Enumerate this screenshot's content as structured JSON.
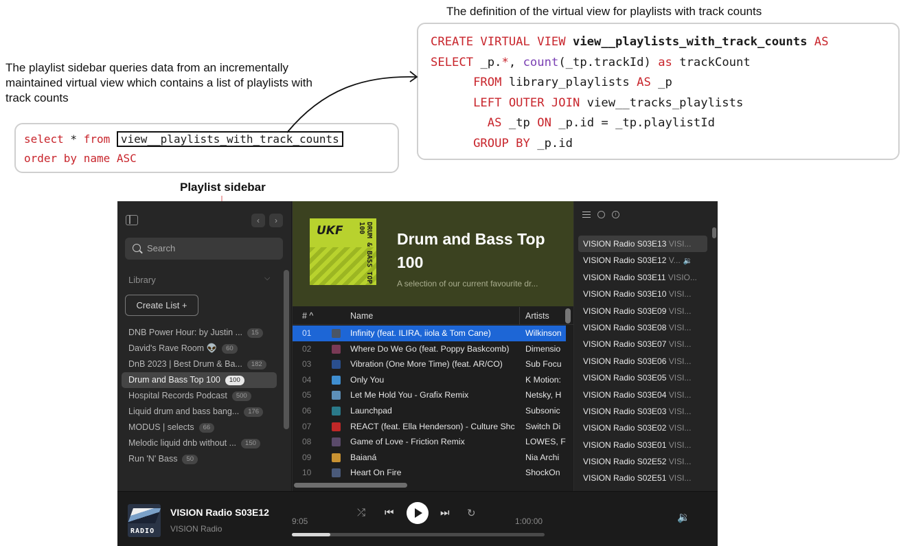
{
  "annotations": {
    "left_caption": "The playlist sidebar queries data from an incrementally maintained virtual view which contains a list of playlists with track counts",
    "right_caption": "The definition of the virtual view for playlists with track counts",
    "sidebar_caption": "Playlist sidebar"
  },
  "query": {
    "kw_select": "select",
    "star": " * ",
    "kw_from": "from ",
    "view_name": "view__playlists_with_track_counts",
    "kw_order": "order by name ASC"
  },
  "definition": {
    "l1_kw": "CREATE VIRTUAL VIEW ",
    "l1_name": "view__playlists_with_track_counts",
    "l1_as": " AS",
    "l2_kw": "SELECT",
    "l2_a": " _p.",
    "l2_star": "*",
    "l2_b": ", ",
    "l2_fn": "count",
    "l2_c": "(_tp.trackId) ",
    "l2_as": "as",
    "l2_d": " trackCount",
    "l3_kw": "      FROM",
    "l3_a": " library_playlists ",
    "l3_as": "AS",
    "l3_b": " _p",
    "l4_kw": "      LEFT OUTER JOIN",
    "l4_a": " view__tracks_playlists",
    "l5_pad": "        ",
    "l5_as": "AS",
    "l5_a": " _tp ",
    "l5_on": "ON",
    "l5_b": " _p.id = _tp.playlistId",
    "l6_kw": "      GROUP BY",
    "l6_a": " _p.id"
  },
  "sidebar": {
    "search_placeholder": "Search",
    "library_label": "Library",
    "create_list_label": "Create List  +",
    "playlists": [
      {
        "name": "DNB Power Hour: by Justin ...",
        "count": "15"
      },
      {
        "name": "David's Rave Room 👽",
        "count": "60"
      },
      {
        "name": "DnB 2023 | Best Drum & Ba...",
        "count": "182"
      },
      {
        "name": "Drum and Bass Top 100",
        "count": "100"
      },
      {
        "name": "Hospital Records Podcast",
        "count": "500"
      },
      {
        "name": "Liquid drum and bass bang...",
        "count": "176"
      },
      {
        "name": "MODUS | selects",
        "count": "66"
      },
      {
        "name": "Melodic liquid dnb without ...",
        "count": "150"
      },
      {
        "name": "Run 'N' Bass",
        "count": "50"
      }
    ]
  },
  "playlist": {
    "cover_logo": "UKF",
    "cover_text": "DRUM & BASS TOP 100",
    "title": "Drum and Bass Top 100",
    "description": "A selection of our current favourite dr..."
  },
  "table": {
    "col_num": "#  ^",
    "col_name": "Name",
    "col_artists": "Artists",
    "rows": [
      {
        "n": "01",
        "title": "Infinity (feat. ILIRA, iiola & Tom Cane)",
        "artist": "Wilkinson",
        "thumb": "#4a5564"
      },
      {
        "n": "02",
        "title": "Where Do We Go (feat. Poppy Baskcomb)",
        "artist": "Dimensio",
        "thumb": "#7a3a56"
      },
      {
        "n": "03",
        "title": "Vibration (One More Time) (feat. AR/CO)",
        "artist": "Sub Focu",
        "thumb": "#2a4f8f"
      },
      {
        "n": "04",
        "title": "Only You",
        "artist": "K Motion:",
        "thumb": "#3f8ed0"
      },
      {
        "n": "05",
        "title": "Let Me Hold You - Grafix Remix",
        "artist": "Netsky, H",
        "thumb": "#5d8fb8"
      },
      {
        "n": "06",
        "title": "Launchpad",
        "artist": "Subsonic",
        "thumb": "#2a7a8a"
      },
      {
        "n": "07",
        "title": "REACT (feat. Ella Henderson) - Culture Shc",
        "artist": "Switch Di",
        "thumb": "#c02828"
      },
      {
        "n": "08",
        "title": "Game of Love - Friction Remix",
        "artist": "LOWES, F",
        "thumb": "#5a4a6a"
      },
      {
        "n": "09",
        "title": "Baianá",
        "artist": "Nia Archi",
        "thumb": "#c89232"
      },
      {
        "n": "10",
        "title": "Heart On Fire",
        "artist": "ShockOn",
        "thumb": "#4a5a7a"
      }
    ]
  },
  "queue": {
    "items": [
      {
        "title": "VISION Radio S03E13",
        "sub": "VISI..."
      },
      {
        "title": "VISION Radio S03E12",
        "sub": "V...",
        "speaker": "🔉"
      },
      {
        "title": "VISION Radio S03E11",
        "sub": "VISIO..."
      },
      {
        "title": "VISION Radio S03E10",
        "sub": "VISI..."
      },
      {
        "title": "VISION Radio S03E09",
        "sub": "VISI..."
      },
      {
        "title": "VISION Radio S03E08",
        "sub": "VISI..."
      },
      {
        "title": "VISION Radio S03E07",
        "sub": "VISI..."
      },
      {
        "title": "VISION Radio S03E06",
        "sub": "VISI..."
      },
      {
        "title": "VISION Radio S03E05",
        "sub": "VISI..."
      },
      {
        "title": "VISION Radio S03E04",
        "sub": "VISI..."
      },
      {
        "title": "VISION Radio S03E03",
        "sub": "VISI..."
      },
      {
        "title": "VISION Radio S03E02",
        "sub": "VISI..."
      },
      {
        "title": "VISION Radio S03E01",
        "sub": "VISI..."
      },
      {
        "title": "VISION Radio S02E52",
        "sub": "VISI..."
      },
      {
        "title": "VISION Radio S02E51",
        "sub": "VISI..."
      }
    ]
  },
  "player": {
    "art_label": "RADIO",
    "title": "VISION Radio S03E12",
    "artist": "VISION Radio",
    "elapsed": "9:05",
    "total": "1:00:00",
    "progress_fraction": 0.151,
    "shuffle_icon": "⤮",
    "prev_icon": "⏮",
    "next_icon": "⏭",
    "repeat_icon": "↻",
    "volume_icon": "🔉"
  },
  "colors": {
    "selected_row": "#1d66d6",
    "sql_keyword": "#c8252c",
    "sql_function": "#7a3fb3",
    "header_bg": "#3b4220",
    "cover_bg": "#b8d22e"
  }
}
